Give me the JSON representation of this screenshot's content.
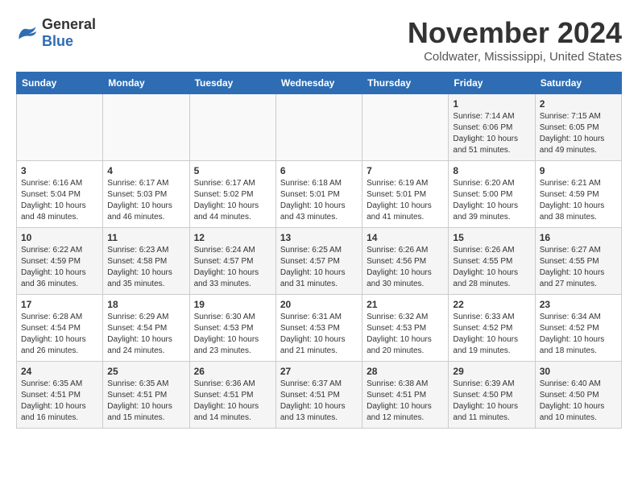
{
  "header": {
    "logo_general": "General",
    "logo_blue": "Blue",
    "title": "November 2024",
    "location": "Coldwater, Mississippi, United States"
  },
  "calendar": {
    "days_of_week": [
      "Sunday",
      "Monday",
      "Tuesday",
      "Wednesday",
      "Thursday",
      "Friday",
      "Saturday"
    ],
    "weeks": [
      {
        "cells": [
          {
            "empty": true
          },
          {
            "empty": true
          },
          {
            "empty": true
          },
          {
            "empty": true
          },
          {
            "empty": true
          },
          {
            "day": "1",
            "sunrise": "Sunrise: 7:14 AM",
            "sunset": "Sunset: 6:06 PM",
            "daylight": "Daylight: 10 hours and 51 minutes."
          },
          {
            "day": "2",
            "sunrise": "Sunrise: 7:15 AM",
            "sunset": "Sunset: 6:05 PM",
            "daylight": "Daylight: 10 hours and 49 minutes."
          }
        ]
      },
      {
        "cells": [
          {
            "day": "3",
            "sunrise": "Sunrise: 6:16 AM",
            "sunset": "Sunset: 5:04 PM",
            "daylight": "Daylight: 10 hours and 48 minutes."
          },
          {
            "day": "4",
            "sunrise": "Sunrise: 6:17 AM",
            "sunset": "Sunset: 5:03 PM",
            "daylight": "Daylight: 10 hours and 46 minutes."
          },
          {
            "day": "5",
            "sunrise": "Sunrise: 6:17 AM",
            "sunset": "Sunset: 5:02 PM",
            "daylight": "Daylight: 10 hours and 44 minutes."
          },
          {
            "day": "6",
            "sunrise": "Sunrise: 6:18 AM",
            "sunset": "Sunset: 5:01 PM",
            "daylight": "Daylight: 10 hours and 43 minutes."
          },
          {
            "day": "7",
            "sunrise": "Sunrise: 6:19 AM",
            "sunset": "Sunset: 5:01 PM",
            "daylight": "Daylight: 10 hours and 41 minutes."
          },
          {
            "day": "8",
            "sunrise": "Sunrise: 6:20 AM",
            "sunset": "Sunset: 5:00 PM",
            "daylight": "Daylight: 10 hours and 39 minutes."
          },
          {
            "day": "9",
            "sunrise": "Sunrise: 6:21 AM",
            "sunset": "Sunset: 4:59 PM",
            "daylight": "Daylight: 10 hours and 38 minutes."
          }
        ]
      },
      {
        "cells": [
          {
            "day": "10",
            "sunrise": "Sunrise: 6:22 AM",
            "sunset": "Sunset: 4:59 PM",
            "daylight": "Daylight: 10 hours and 36 minutes."
          },
          {
            "day": "11",
            "sunrise": "Sunrise: 6:23 AM",
            "sunset": "Sunset: 4:58 PM",
            "daylight": "Daylight: 10 hours and 35 minutes."
          },
          {
            "day": "12",
            "sunrise": "Sunrise: 6:24 AM",
            "sunset": "Sunset: 4:57 PM",
            "daylight": "Daylight: 10 hours and 33 minutes."
          },
          {
            "day": "13",
            "sunrise": "Sunrise: 6:25 AM",
            "sunset": "Sunset: 4:57 PM",
            "daylight": "Daylight: 10 hours and 31 minutes."
          },
          {
            "day": "14",
            "sunrise": "Sunrise: 6:26 AM",
            "sunset": "Sunset: 4:56 PM",
            "daylight": "Daylight: 10 hours and 30 minutes."
          },
          {
            "day": "15",
            "sunrise": "Sunrise: 6:26 AM",
            "sunset": "Sunset: 4:55 PM",
            "daylight": "Daylight: 10 hours and 28 minutes."
          },
          {
            "day": "16",
            "sunrise": "Sunrise: 6:27 AM",
            "sunset": "Sunset: 4:55 PM",
            "daylight": "Daylight: 10 hours and 27 minutes."
          }
        ]
      },
      {
        "cells": [
          {
            "day": "17",
            "sunrise": "Sunrise: 6:28 AM",
            "sunset": "Sunset: 4:54 PM",
            "daylight": "Daylight: 10 hours and 26 minutes."
          },
          {
            "day": "18",
            "sunrise": "Sunrise: 6:29 AM",
            "sunset": "Sunset: 4:54 PM",
            "daylight": "Daylight: 10 hours and 24 minutes."
          },
          {
            "day": "19",
            "sunrise": "Sunrise: 6:30 AM",
            "sunset": "Sunset: 4:53 PM",
            "daylight": "Daylight: 10 hours and 23 minutes."
          },
          {
            "day": "20",
            "sunrise": "Sunrise: 6:31 AM",
            "sunset": "Sunset: 4:53 PM",
            "daylight": "Daylight: 10 hours and 21 minutes."
          },
          {
            "day": "21",
            "sunrise": "Sunrise: 6:32 AM",
            "sunset": "Sunset: 4:53 PM",
            "daylight": "Daylight: 10 hours and 20 minutes."
          },
          {
            "day": "22",
            "sunrise": "Sunrise: 6:33 AM",
            "sunset": "Sunset: 4:52 PM",
            "daylight": "Daylight: 10 hours and 19 minutes."
          },
          {
            "day": "23",
            "sunrise": "Sunrise: 6:34 AM",
            "sunset": "Sunset: 4:52 PM",
            "daylight": "Daylight: 10 hours and 18 minutes."
          }
        ]
      },
      {
        "cells": [
          {
            "day": "24",
            "sunrise": "Sunrise: 6:35 AM",
            "sunset": "Sunset: 4:51 PM",
            "daylight": "Daylight: 10 hours and 16 minutes."
          },
          {
            "day": "25",
            "sunrise": "Sunrise: 6:35 AM",
            "sunset": "Sunset: 4:51 PM",
            "daylight": "Daylight: 10 hours and 15 minutes."
          },
          {
            "day": "26",
            "sunrise": "Sunrise: 6:36 AM",
            "sunset": "Sunset: 4:51 PM",
            "daylight": "Daylight: 10 hours and 14 minutes."
          },
          {
            "day": "27",
            "sunrise": "Sunrise: 6:37 AM",
            "sunset": "Sunset: 4:51 PM",
            "daylight": "Daylight: 10 hours and 13 minutes."
          },
          {
            "day": "28",
            "sunrise": "Sunrise: 6:38 AM",
            "sunset": "Sunset: 4:51 PM",
            "daylight": "Daylight: 10 hours and 12 minutes."
          },
          {
            "day": "29",
            "sunrise": "Sunrise: 6:39 AM",
            "sunset": "Sunset: 4:50 PM",
            "daylight": "Daylight: 10 hours and 11 minutes."
          },
          {
            "day": "30",
            "sunrise": "Sunrise: 6:40 AM",
            "sunset": "Sunset: 4:50 PM",
            "daylight": "Daylight: 10 hours and 10 minutes."
          }
        ]
      }
    ]
  }
}
